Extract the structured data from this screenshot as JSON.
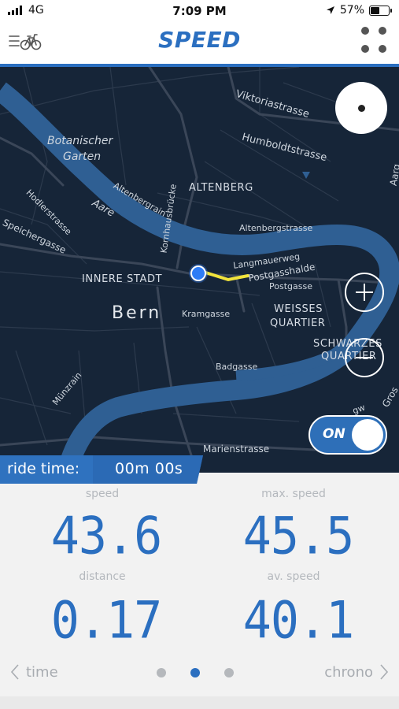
{
  "status": {
    "carrier": "4G",
    "time": "7:09 PM",
    "battery": "57%",
    "battery_level": 0.57
  },
  "header": {
    "title": "SPEED",
    "menu_icon": "menu-bike-icon",
    "grid_icon": "four-dots-icon"
  },
  "map": {
    "labels": {
      "viktoriastrasse": "Viktoriastrasse",
      "humboldtstrasse": "Humboldtstrasse",
      "botanischer1": "Botanischer",
      "botanischer2": "Garten",
      "altenberg": "ALTENBERG",
      "altenbergrain": "Altenbergrain",
      "aare": "Aare",
      "kornhausbrucke": "Kornhausbrücke",
      "hodlerstrasse": "Hodlerstrasse",
      "speichergasse": "Speichergasse",
      "altenbergstrasse": "Altenbergstrasse",
      "langmauerweg": "Langmauerweg",
      "innere_stadt": "INNERE STADT",
      "postgasshalde": "Postgasshalde",
      "postgasse": "Postgasse",
      "bern": "Bern",
      "kramgasse": "Kramgasse",
      "weisses": "WEISSES",
      "quartier": "QUARTIER",
      "schwarzes": "SCHWARZES",
      "quartier2": "QUARTIER",
      "badgasse": "Badgasse",
      "munzrain": "Münzrain",
      "marienstrasse": "Marienstrasse",
      "aarg": "Aarg",
      "gros": "Gros",
      "gw": "gw"
    },
    "toggle_label": "ON"
  },
  "ride": {
    "label": "ride time:",
    "value": "00m 00s"
  },
  "stats": {
    "speed_label": "speed",
    "speed_value": "43.6",
    "max_label": "max. speed",
    "max_value": "45.5",
    "distance_label": "distance",
    "distance_value": "0.17",
    "avg_label": "av. speed",
    "avg_value": "40.1"
  },
  "nav": {
    "prev_label": "time",
    "next_label": "chrono",
    "page_count": 3,
    "active_page": 2
  },
  "colors": {
    "accent": "#2b6fc0",
    "map_bg": "#162538",
    "river": "#2f5f93",
    "route": "#f2e43c"
  }
}
